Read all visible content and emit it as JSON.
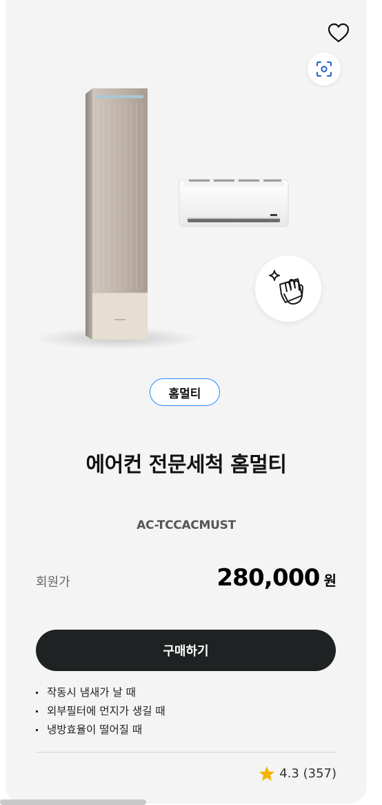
{
  "product": {
    "tag": "홈멀티",
    "title": "에어컨 전문세척 홈멀티",
    "model": "AC-TCCACMUST"
  },
  "price": {
    "label": "회원가",
    "amount": "280,000",
    "currency": "원"
  },
  "buy_button": {
    "label": "구매하기"
  },
  "features": [
    "작동시 냄새가 날 때",
    "외부필터에 먼지가 생길 때",
    "냉방효율이 떨어질 때"
  ],
  "rating": {
    "text": "4.3 (357)",
    "value": 4.3,
    "count": 357
  },
  "colors": {
    "tag_border": "#2189ff",
    "button_bg": "#1f2223",
    "star": "#f5b400",
    "ar_icon": "#1f5fc8"
  },
  "icons": {
    "wishlist": "heart-icon",
    "ar_view": "ar-scan-icon",
    "cleaning": "cleaning-hand-icon",
    "rating": "star-icon"
  }
}
